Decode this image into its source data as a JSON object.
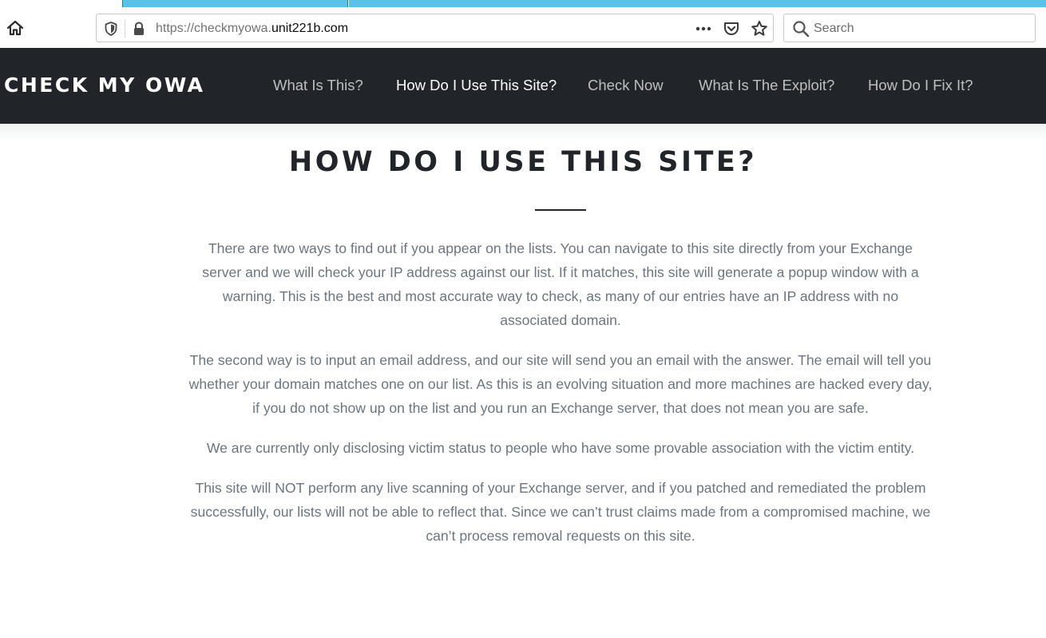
{
  "browser": {
    "url_prefix": "https://checkmyowa.",
    "url_host": "unit221b.com",
    "search_placeholder": "Search"
  },
  "site": {
    "brand": "CHECK MY OWA",
    "nav": [
      {
        "label": "What Is This?",
        "active": false
      },
      {
        "label": "How Do I Use This Site?",
        "active": true
      },
      {
        "label": "Check Now",
        "active": false
      },
      {
        "label": "What Is The Exploit?",
        "active": false
      },
      {
        "label": "How Do I Fix It?",
        "active": false
      }
    ]
  },
  "main": {
    "title": "HOW DO I USE THIS SITE?",
    "paragraphs": [
      "There are two ways to find out if you appear on the lists. You can navigate to this site directly from your Exchange server and we will check your IP address against our list. If it matches, this site will generate a popup window with a warning. This is the best and most accurate way to check, as many of our entries have an IP address with no associated domain.",
      "The second way is to input an email address, and our site will send you an email with the answer. The email will tell you whether your domain matches one on our list. As this is an evolving situation and more machines are hacked every day, if you do not show up on the list and you run an Exchange server, that does not mean you are safe.",
      "We are currently only disclosing victim status to people who have some provable association with the victim entity.",
      "This site will NOT perform any live scanning of your Exchange server, and if you patched and remediated the problem successfully, our lists will not be able to reflect that. Since we can’t trust claims made from a compromised machine, we can’t process removal requests on this site."
    ]
  },
  "colors": {
    "header_bg": "#212529",
    "tab_accent": "#5bc2e7",
    "body_text": "#6c757d"
  }
}
